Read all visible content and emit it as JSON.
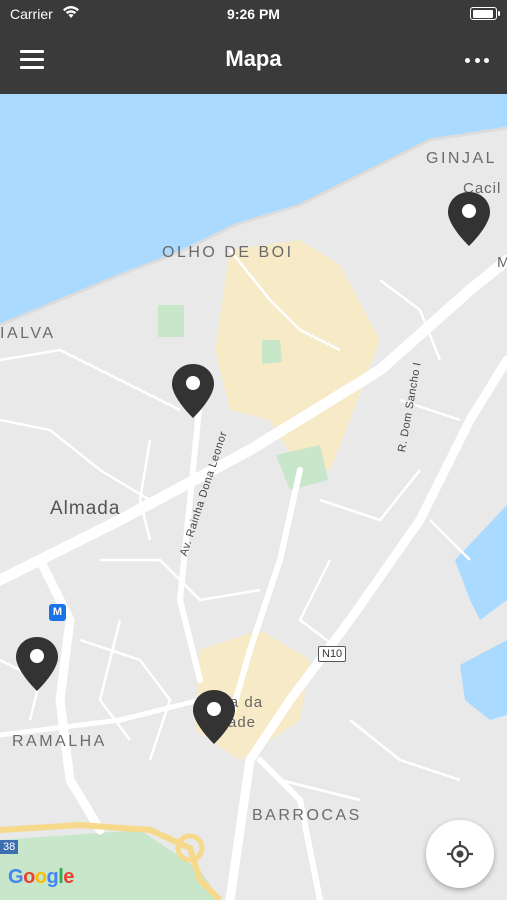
{
  "status_bar": {
    "carrier": "Carrier",
    "time": "9:26 PM"
  },
  "nav": {
    "title": "Mapa"
  },
  "map": {
    "labels": {
      "ginjal": "GINJAL",
      "cacil": "Cacil",
      "m_edge": "M",
      "olho_de_boi": "OLHO DE BOI",
      "ialva": "IALVA",
      "almada": "Almada",
      "ramalha": "RAMALHA",
      "barrocas": "BARROCAS",
      "cova_1": "ova da",
      "cova_2": "ade",
      "av_rainha": "Av. Rainha Dona Leonor",
      "r_dom_sancho": "R. Dom Sancho I"
    },
    "badges": {
      "metro": "M",
      "road": "N10",
      "route": "38"
    },
    "attribution": {
      "letters": [
        "G",
        "o",
        "o",
        "g",
        "l",
        "e"
      ]
    },
    "colors": {
      "water": "#aadaff",
      "land": "#e9e9e9",
      "road": "#ffffff",
      "built": "#f7eac6",
      "park": "#c8e6c9",
      "pin": "#333333"
    }
  }
}
